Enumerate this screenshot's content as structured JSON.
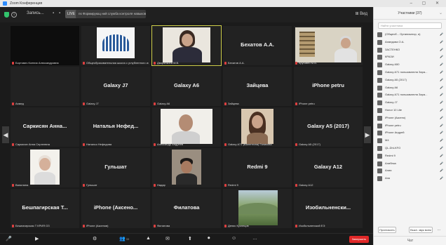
{
  "window": {
    "title": "Zoom Конференция"
  },
  "topbar": {
    "meeting_label": "Запись...",
    "rec_label": "LIVE",
    "pill_text": "ns Формирующ ний служба контроля навыков",
    "view_label": "Вид"
  },
  "tiles": [
    {
      "big": "",
      "name": "Бортович Ксения Александровна",
      "photo": "dark"
    },
    {
      "big": "",
      "name": "Общеобразовательная школа с углубленного изуч",
      "photo": "logo"
    },
    {
      "big": "",
      "name": "Дворянкина М.В.",
      "photo": "woman",
      "selected": true
    },
    {
      "big": "Бехатов А.А.",
      "name": "Бехатов А.А."
    },
    {
      "big": "",
      "name": "Круговей М.В.",
      "photo": "office"
    },
    {
      "big": "",
      "name": "Ахмед",
      "photo": "none"
    },
    {
      "big": "Galaxy J7",
      "name": "Galaxy J7"
    },
    {
      "big": "Galaxy A6",
      "name": "Galaxy A6"
    },
    {
      "big": "Зайцева",
      "name": "Зайцева"
    },
    {
      "big": "iPhone petru",
      "name": "iPhone petru"
    },
    {
      "big": "Саркисян Анна...",
      "name": "Саркисян Анна Сергеевна"
    },
    {
      "big": "Наталья Нефед...",
      "name": "Наталья Нефедова"
    },
    {
      "big": "",
      "name": "Александр Андреев",
      "photo": "man"
    },
    {
      "big": "",
      "name": "Galaxy A71 (Валентина) Галикова",
      "photo": "woman2"
    },
    {
      "big": "Galaxy A5 (2017)",
      "name": "Galaxy A5 (2017)"
    },
    {
      "big": "",
      "name": "Ванилина",
      "photo": "lady"
    },
    {
      "big": "Гульшат",
      "name": "Гульшат"
    },
    {
      "big": "",
      "name": "Надир",
      "photo": "man2"
    },
    {
      "big": "Redmi 9",
      "name": "Redmi 9"
    },
    {
      "big": "Galaxy A12",
      "name": "Galaxy A12"
    },
    {
      "big": "Бешпагирская Т...",
      "name": "Бешпагирская Т КРИЯ ОЗ"
    },
    {
      "big": "iPhone (Аксено...",
      "name": "iPhone (Аксенов)"
    },
    {
      "big": "Филатова",
      "name": "Филатова"
    },
    {
      "big": "",
      "name": "Денис Кузнецов",
      "photo": "landscape"
    },
    {
      "big": "Изобильненски...",
      "name": "Изобильненский ЕЭ"
    }
  ],
  "toolbar": {
    "items": [
      {
        "icon": "🎤",
        "label": ""
      },
      {
        "icon": "▶",
        "label": ""
      },
      {
        "icon": "⚙",
        "label": ""
      },
      {
        "icon": "👥",
        "label": "33"
      },
      {
        "icon": "▲",
        "label": ""
      },
      {
        "icon": "✉",
        "label": ""
      },
      {
        "icon": "⬆",
        "label": ""
      },
      {
        "icon": "⏺",
        "label": ""
      },
      {
        "icon": "☺",
        "label": ""
      },
      {
        "icon": "…",
        "label": ""
      }
    ],
    "end_label": "Завершить"
  },
  "panel": {
    "title": "Участники (37)",
    "search_placeholder": "Найти участника",
    "participants": [
      {
        "name": "(Общеоб... Организатор, я)",
        "status": "🎤"
      },
      {
        "name": "Ахмедова О.А.",
        "status": "🎤"
      },
      {
        "name": "ЗАСТЕНКО",
        "status": "🎤"
      },
      {
        "name": "КРАЗИ",
        "status": "🎤"
      },
      {
        "name": "Galaxy A50",
        "status": "🎤"
      },
      {
        "name": "Galaxy A71 пользователя Зара...",
        "status": "🎤"
      },
      {
        "name": "Galaxy A5 (2017)",
        "status": "🎤"
      },
      {
        "name": "Galaxy A6",
        "status": "🎤"
      },
      {
        "name": "Galaxy A71 пользователя Зара...",
        "status": "🎤"
      },
      {
        "name": "Galaxy J7",
        "status": "🎤"
      },
      {
        "name": "Honor 10 Lite",
        "status": "🎤"
      },
      {
        "name": "iPhone (Аксено)",
        "status": "🎤"
      },
      {
        "name": "iPhone petru",
        "status": "🎤"
      },
      {
        "name": "iPhone Андрей",
        "status": "🎤"
      },
      {
        "name": "M4",
        "status": "🎤"
      },
      {
        "name": "QL-Dhl-KFO",
        "status": "🎤"
      },
      {
        "name": "Redmi 9",
        "status": "🎤"
      },
      {
        "name": "Алибека",
        "status": "🎤"
      },
      {
        "name": "Алия",
        "status": "🎤"
      },
      {
        "name": "Аня",
        "status": "🎤"
      }
    ],
    "invite_label": "Пригласить",
    "mute_all_label": "Выкл. звук всем",
    "more_label": "...",
    "chat_label": "Чат"
  }
}
